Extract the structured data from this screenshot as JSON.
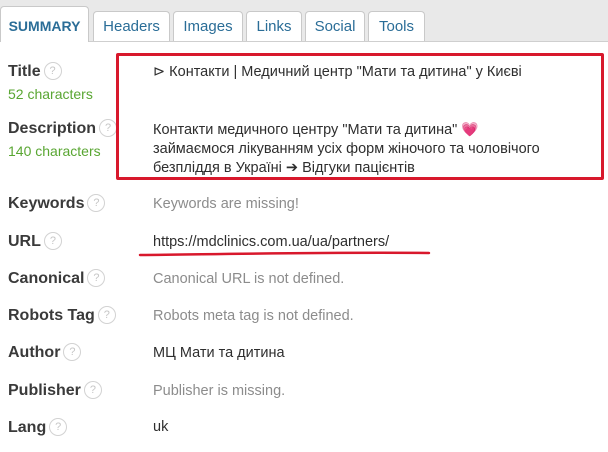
{
  "tabs": [
    {
      "label": "SUMMARY",
      "active": true
    },
    {
      "label": "Headers",
      "active": false
    },
    {
      "label": "Images",
      "active": false
    },
    {
      "label": "Links",
      "active": false
    },
    {
      "label": "Social",
      "active": false
    },
    {
      "label": "Tools",
      "active": false
    }
  ],
  "help_icon": {
    "glyph": "?"
  },
  "rows": {
    "title": {
      "label": "Title",
      "count": "52 characters",
      "value": "⊳ Контакти | Медичний центр \"Мати та дитина\" у Києві"
    },
    "description": {
      "label": "Description",
      "count": "140 characters",
      "line1": "Контакти медичного центру \"Мати та дитина\"",
      "heart": "💗",
      "line2": "займаємося лікуванням усіх форм жіночого та чоловічого",
      "line3": "безпліддя в Україні ➔ Відгуки пацієнтів"
    },
    "keywords": {
      "label": "Keywords",
      "value": "Keywords are missing!"
    },
    "url": {
      "label": "URL",
      "value": "https://mdclinics.com.ua/ua/partners/"
    },
    "canonical": {
      "label": "Canonical",
      "value": "Canonical URL is not defined."
    },
    "robots": {
      "label": "Robots Tag",
      "value": "Robots meta tag is not defined."
    },
    "author": {
      "label": "Author",
      "value": "МЦ Мати та дитина"
    },
    "publisher": {
      "label": "Publisher",
      "value": "Publisher is missing."
    },
    "lang": {
      "label": "Lang",
      "value": "uk"
    }
  },
  "colors": {
    "tab_text": "#2a6d97",
    "count_green": "#59a632",
    "annotation_red": "#d8182c",
    "missing_gray": "#8c8c8c"
  }
}
